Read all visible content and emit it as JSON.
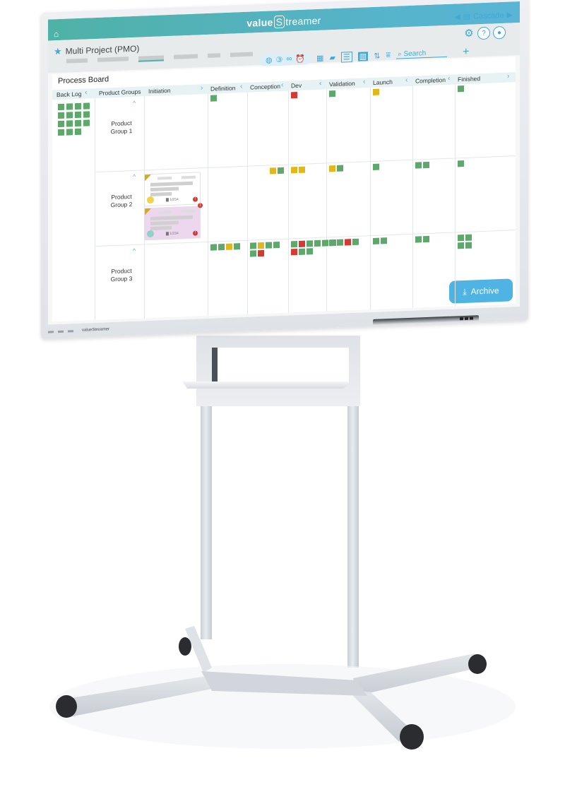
{
  "app": {
    "brand_prefix": "value",
    "brand_suffix": "treamer",
    "brand_s": "S"
  },
  "top_icons": [
    "gear-icon",
    "help-icon",
    "user-icon"
  ],
  "icons_glyphs": {
    "gear": "⚙",
    "help": "?",
    "user": "●",
    "home": "⌂",
    "star": "★",
    "cascade": "▤"
  },
  "nav": {
    "cascade_label": "Cascade",
    "prev": "◀",
    "next": "▶"
  },
  "project": {
    "title": "Multi Project (PMO)"
  },
  "toolbar": {
    "filter_count": "3",
    "icons": {
      "globe": "◍",
      "count": "③",
      "infinity": "∞",
      "alarm": "⏰",
      "grid": "▦",
      "board": "▰",
      "list": "☰",
      "columns": "▥",
      "sort": "⇅",
      "filter": "⩸",
      "search": "⌕"
    },
    "search_placeholder": "Search",
    "add": "+"
  },
  "board": {
    "title": "Process Board",
    "backlog_label": "Back Log",
    "groups_header": "Product Groups",
    "columns": [
      "Initiation",
      "Definition",
      "Conception",
      "Dev",
      "Validation",
      "Launch",
      "Completion",
      "Finished"
    ],
    "groups": [
      {
        "label_line1": "Product",
        "label_line2": "Group 1"
      },
      {
        "label_line1": "Product",
        "label_line2": "Group 2"
      },
      {
        "label_line1": "Product",
        "label_line2": "Group 3"
      }
    ],
    "backlog_tiles": [
      "g",
      "g",
      "g",
      "g",
      "g",
      "g",
      "g",
      "g",
      "g",
      "g",
      "g",
      "g",
      "g",
      "g",
      "g"
    ],
    "cards": [
      {
        "meta": "1/234",
        "style": "white"
      },
      {
        "meta": "1/234",
        "style": "pink",
        "badge": "1"
      }
    ],
    "cells": {
      "row1": {
        "Definition": [
          "g"
        ],
        "Dev": [
          "r"
        ],
        "Validation": [
          "g"
        ],
        "Launch": [
          "y"
        ],
        "Finished": [
          "g"
        ]
      },
      "row2": {
        "Conception": [
          "y",
          "g"
        ],
        "Dev": [
          "y",
          "y"
        ],
        "Validation": [
          "y",
          "g"
        ],
        "Launch": [
          "g"
        ],
        "Completion": [
          "g",
          "g"
        ],
        "Finished": [
          "g"
        ]
      },
      "row3": {
        "Definition": [
          "g",
          "g",
          "y",
          "g"
        ],
        "Conception": [
          "g",
          "y",
          "g",
          "g",
          "g",
          "r"
        ],
        "Dev": [
          "g",
          "r",
          "g",
          "g",
          "g",
          "g",
          "r",
          "g",
          "g"
        ],
        "Validation": [
          "g",
          "g",
          "r",
          "g"
        ],
        "Launch": [
          "g",
          "g"
        ],
        "Completion": [
          "g",
          "g"
        ],
        "Finished": [
          "g",
          "g",
          "g",
          "g"
        ]
      }
    },
    "archive_label": "Archive",
    "collapse_glyph": "^",
    "chevron_left": "‹",
    "chevron_right": "›"
  },
  "colors": {
    "accent": "#3fa9d8",
    "header_gradient_start": "#4fb2a6",
    "header_gradient_end": "#58b5d6",
    "status_green": "#5fa86b",
    "status_yellow": "#e0b81a",
    "status_red": "#d23a32",
    "archive_button": "#4fb3e3"
  }
}
